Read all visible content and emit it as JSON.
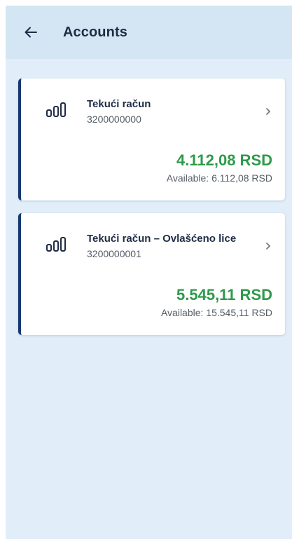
{
  "header": {
    "back_icon": "arrow-left-icon",
    "title": "Accounts"
  },
  "accounts": [
    {
      "icon": "bar-chart-icon",
      "name": "Tekući račun",
      "number": "3200000000",
      "amount": "4.112,08 RSD",
      "available": "Available: 6.112,08 RSD",
      "chevron_icon": "chevron-right-icon"
    },
    {
      "icon": "bar-chart-icon",
      "name": "Tekući račun – Ovlašćeno lice",
      "number": "3200000001",
      "amount": "5.545,11 RSD",
      "available": "Available: 15.545,11 RSD",
      "chevron_icon": "chevron-right-icon"
    }
  ],
  "colors": {
    "header_bg": "#d4e6f4",
    "screen_bg": "#e1eef9",
    "accent_border": "#17386f",
    "amount_green": "#2e9a4a"
  }
}
